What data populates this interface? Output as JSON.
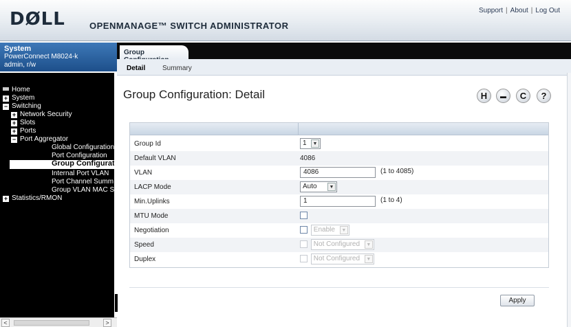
{
  "header": {
    "logo": "DØLL",
    "title": "OPENMANAGE™ SWITCH ADMINISTRATOR",
    "links": [
      "Support",
      "About",
      "Log Out"
    ],
    "separator": "|"
  },
  "system": {
    "title": "System",
    "device": "PowerConnect M8024-k",
    "user": "admin, r/w"
  },
  "tree": {
    "items": [
      {
        "label": "Home"
      },
      {
        "label": "System"
      },
      {
        "label": "Switching"
      },
      {
        "label": "Network Security"
      },
      {
        "label": "Slots"
      },
      {
        "label": "Ports"
      },
      {
        "label": "Port Aggregator"
      },
      {
        "label": "Global Configuration"
      },
      {
        "label": "Port Configuration"
      },
      {
        "label": "Group Configurati"
      },
      {
        "label": "Internal Port VLAN"
      },
      {
        "label": "Port Channel Summ"
      },
      {
        "label": "Group VLAN MAC S"
      },
      {
        "label": "Statistics/RMON"
      }
    ],
    "expand_symbol": "+",
    "collapse_symbol": "−"
  },
  "scroll": {
    "left_arrow": "<",
    "right_arrow": ">"
  },
  "tab": {
    "label": "Group Configuration"
  },
  "subtabs": {
    "detail": "Detail",
    "summary": "Summary"
  },
  "page_title": "Group Configuration: Detail",
  "toolbar": {
    "save_glyph": "H",
    "print_glyph": "▬",
    "refresh_glyph": "C",
    "help_glyph": "?"
  },
  "form": {
    "group_id": {
      "label": "Group Id",
      "value": "1"
    },
    "default_vlan": {
      "label": "Default VLAN",
      "value": "4086"
    },
    "vlan": {
      "label": "VLAN",
      "value": "4086",
      "range": "(1 to 4085)"
    },
    "lacp_mode": {
      "label": "LACP Mode",
      "value": "Auto"
    },
    "min_uplinks": {
      "label": "Min.Uplinks",
      "value": "1",
      "range": "(1 to 4)"
    },
    "mtu_mode": {
      "label": "MTU Mode"
    },
    "negotiation": {
      "label": "Negotiation",
      "value": "Enable"
    },
    "speed": {
      "label": "Speed",
      "value": "Not Configured"
    },
    "duplex": {
      "label": "Duplex",
      "value": "Not Configured"
    }
  },
  "apply_label": "Apply",
  "dropdown_arrow": "▼"
}
